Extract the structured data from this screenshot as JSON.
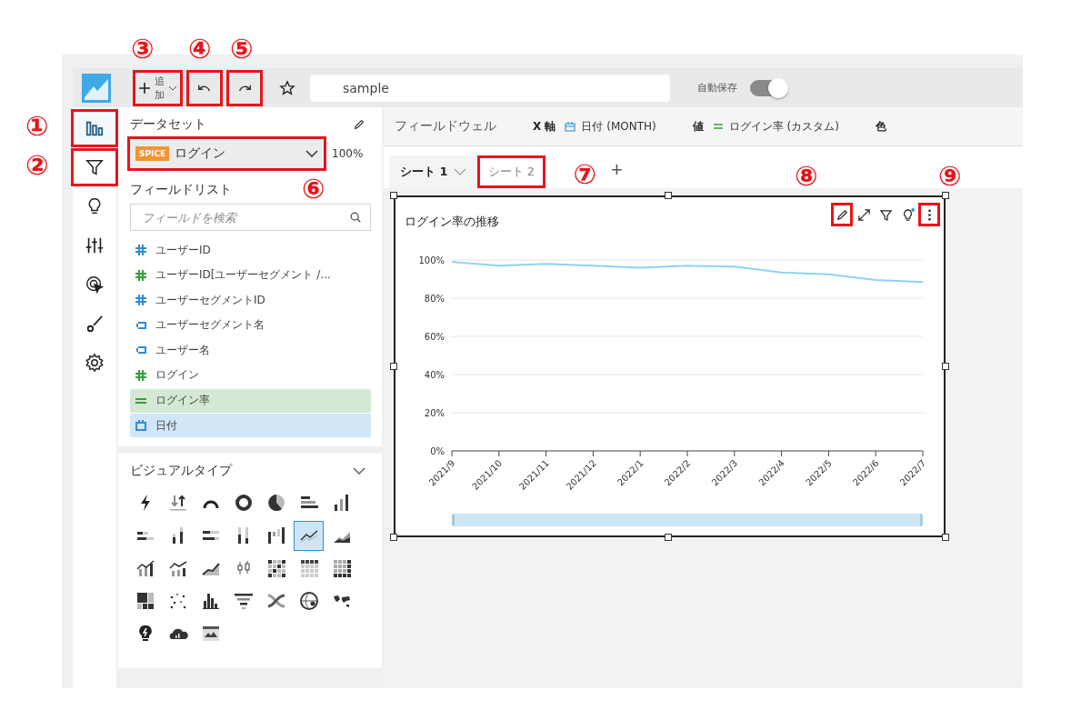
{
  "header": {
    "add_button": {
      "label": "追加",
      "highlighted": true,
      "callout": "③"
    },
    "undo": {
      "highlighted": true,
      "callout": "④"
    },
    "redo": {
      "highlighted": true,
      "callout": "⑤"
    },
    "title_field": {
      "value": "sample"
    },
    "autosave": {
      "label": "自動保存",
      "on": true
    }
  },
  "rail": [
    {
      "kind": "visuals",
      "selected": true,
      "highlighted": true,
      "callout": "①"
    },
    {
      "kind": "filter",
      "selected": false,
      "highlighted": true,
      "callout": "②"
    },
    {
      "kind": "insights",
      "selected": false,
      "highlighted": false
    },
    {
      "kind": "parameters",
      "selected": false,
      "highlighted": false
    },
    {
      "kind": "actions",
      "selected": false,
      "highlighted": false
    },
    {
      "kind": "themes",
      "selected": false,
      "highlighted": false
    },
    {
      "kind": "settings",
      "selected": false,
      "highlighted": false
    }
  ],
  "dataset": {
    "title": "データセット",
    "badge": "SPICE",
    "name": "ログイン",
    "percent": "100%",
    "highlighted": true,
    "callout": "⑥"
  },
  "field_list": {
    "title": "フィールドリスト",
    "search_placeholder": "フィールドを検索",
    "fields": [
      {
        "kind": "number",
        "color": "#2d8ed6",
        "label": "ユーザーID",
        "selected": false
      },
      {
        "kind": "number",
        "color": "#3c9b3c",
        "label": "ユーザーID[ユーザーセグメント /...",
        "selected": false
      },
      {
        "kind": "number",
        "color": "#2d8ed6",
        "label": "ユーザーセグメントID",
        "selected": false
      },
      {
        "kind": "string",
        "color": "#2d8ed6",
        "label": "ユーザーセグメント名",
        "selected": false
      },
      {
        "kind": "string",
        "color": "#2d8ed6",
        "label": "ユーザー名",
        "selected": false
      },
      {
        "kind": "number",
        "color": "#3c9b3c",
        "label": "ログイン",
        "selected": false
      },
      {
        "kind": "calc",
        "color": "#3c9b3c",
        "label": "ログイン率",
        "selected": true
      },
      {
        "kind": "date",
        "color": "#2d8ed6",
        "label": "日付",
        "selected": true
      }
    ]
  },
  "visual_types": {
    "title": "ビジュアルタイプ",
    "items": [
      {
        "kind": "kpi",
        "selected": false
      },
      {
        "kind": "arrows",
        "selected": false
      },
      {
        "kind": "gauge",
        "selected": false
      },
      {
        "kind": "donut",
        "selected": false
      },
      {
        "kind": "pie",
        "selected": false
      },
      {
        "kind": "hbar",
        "selected": false
      },
      {
        "kind": "vbar",
        "selected": false
      },
      {
        "kind": "hbar-stacked",
        "selected": false
      },
      {
        "kind": "vbar-stacked",
        "selected": false
      },
      {
        "kind": "hbar-100",
        "selected": false
      },
      {
        "kind": "vbar-100",
        "selected": false
      },
      {
        "kind": "waterfall",
        "selected": false
      },
      {
        "kind": "line",
        "selected": true
      },
      {
        "kind": "area",
        "selected": false
      },
      {
        "kind": "combo",
        "selected": false
      },
      {
        "kind": "combo-2",
        "selected": false
      },
      {
        "kind": "area-line",
        "selected": false
      },
      {
        "kind": "boxplot",
        "selected": false
      },
      {
        "kind": "heatmap",
        "selected": false
      },
      {
        "kind": "pivot",
        "selected": false
      },
      {
        "kind": "table",
        "selected": false
      },
      {
        "kind": "treemap",
        "selected": false
      },
      {
        "kind": "scatter",
        "selected": false
      },
      {
        "kind": "histogram",
        "selected": false
      },
      {
        "kind": "funnel",
        "selected": false
      },
      {
        "kind": "sankey",
        "selected": false
      },
      {
        "kind": "globe",
        "selected": false
      },
      {
        "kind": "map",
        "selected": false
      },
      {
        "kind": "insight",
        "selected": false
      },
      {
        "kind": "cloud",
        "selected": false
      },
      {
        "kind": "image",
        "selected": false
      }
    ]
  },
  "field_wells": {
    "title": "フィールドウェル",
    "wells": [
      {
        "label": "X 軸",
        "kind": "date",
        "value": "日付 (MONTH)"
      },
      {
        "label": "値",
        "kind": "calc",
        "value": "ログイン率 (カスタム)"
      },
      {
        "label": "色"
      }
    ]
  },
  "sheets": [
    {
      "label": "シート 1",
      "selected": true,
      "highlighted": false
    },
    {
      "label": "シート 2",
      "selected": false,
      "highlighted": true,
      "callout": "⑦"
    }
  ],
  "add_sheet": "+",
  "visual": {
    "title": "ログイン率の推移",
    "toolbar": [
      {
        "kind": "edit",
        "highlighted": true,
        "callout": "⑧",
        "dot": false
      },
      {
        "kind": "expand",
        "highlighted": false,
        "dot": false
      },
      {
        "kind": "filter",
        "highlighted": false,
        "dot": false
      },
      {
        "kind": "insight",
        "highlighted": false,
        "dot": true
      },
      {
        "kind": "more",
        "highlighted": true,
        "callout": "⑨",
        "dot": false
      }
    ],
    "chart_data": {
      "type": "line",
      "grid": true,
      "categories": [
        "2021/9",
        "2021/10",
        "2021/11",
        "2021/12",
        "2022/1",
        "2022/2",
        "2022/3",
        "2022/4",
        "2022/5",
        "2022/6",
        "2022/7"
      ],
      "series": [
        {
          "color": "#8fd3ee",
          "values": [
            99,
            97,
            98,
            97,
            96,
            97,
            96.5,
            93.5,
            92.5,
            89.5,
            88.5
          ]
        }
      ],
      "ylim": [
        0,
        100
      ],
      "yticks": [
        {
          "value": 0,
          "label": "0%"
        },
        {
          "value": 20,
          "label": "20%"
        },
        {
          "value": 40,
          "label": "40%"
        },
        {
          "value": 60,
          "label": "60%"
        },
        {
          "value": 80,
          "label": "80%"
        },
        {
          "value": 100,
          "label": "100%"
        }
      ]
    },
    "range_slider": {
      "level": 1
    }
  }
}
